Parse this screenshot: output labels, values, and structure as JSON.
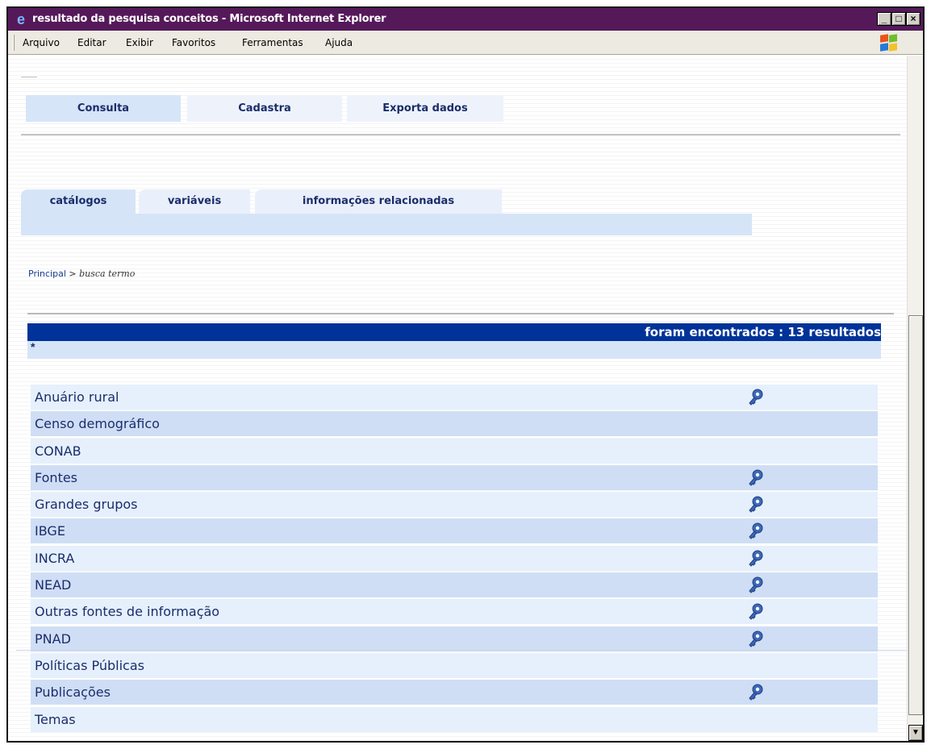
{
  "window": {
    "title": "resultado da pesquisa conceitos - Microsoft Internet Explorer",
    "controls": {
      "minimize": "_",
      "maximize": "□",
      "close": "×"
    }
  },
  "menu": [
    {
      "label": "Arquivo"
    },
    {
      "label": "Editar"
    },
    {
      "label": "Exibir"
    },
    {
      "label": "Favoritos"
    },
    {
      "label": "Ferramentas"
    },
    {
      "label": "Ajuda"
    }
  ],
  "nav_tabs": [
    {
      "label": "Consulta",
      "active": true
    },
    {
      "label": "Cadastra",
      "active": false
    },
    {
      "label": "Exporta dados",
      "active": false
    }
  ],
  "sub_tabs": [
    {
      "label": "catálogos",
      "active": true
    },
    {
      "label": "variáveis",
      "active": false
    },
    {
      "label": "informações relacionadas",
      "active": false
    }
  ],
  "breadcrumb": {
    "home": "Principal",
    "separator": ">",
    "current": "busca termo"
  },
  "results": {
    "header": "foram encontrados : 13 resultados",
    "query": "*",
    "items": [
      {
        "label": "Anuário rural",
        "has_icon": true
      },
      {
        "label": "Censo demográfico",
        "has_icon": false
      },
      {
        "label": "CONAB",
        "has_icon": false
      },
      {
        "label": "Fontes",
        "has_icon": true
      },
      {
        "label": "Grandes grupos",
        "has_icon": true
      },
      {
        "label": "IBGE",
        "has_icon": true
      },
      {
        "label": "INCRA",
        "has_icon": true
      },
      {
        "label": "NEAD",
        "has_icon": true
      },
      {
        "label": "Outras fontes de informação",
        "has_icon": true
      },
      {
        "label": "PNAD",
        "has_icon": true
      },
      {
        "label": "Políticas Públicas",
        "has_icon": false
      },
      {
        "label": "Publicações",
        "has_icon": true
      },
      {
        "label": "Temas",
        "has_icon": false
      }
    ]
  },
  "colors": {
    "titlebar": "#55195a",
    "result_header": "#003399",
    "row_light": "#e6f0fc",
    "row_dark": "#cfdef5",
    "link_text": "#1b2d6b",
    "key_icon": "#3d68b8"
  },
  "icons": {
    "row_action": "key-icon",
    "browser": "ie-icon",
    "brand": "windows-logo"
  }
}
